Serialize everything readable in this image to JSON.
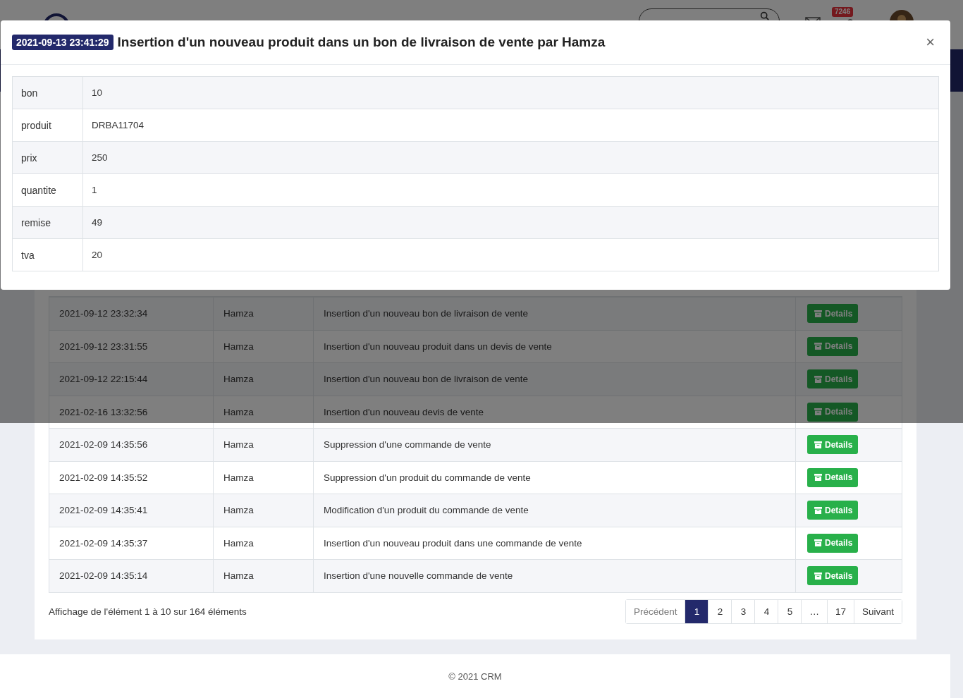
{
  "header": {
    "notification_count": "7246"
  },
  "modal": {
    "timestamp": "2021-09-13 23:41:29",
    "title": "Insertion d'un nouveau produit dans un bon de livraison de vente par Hamza",
    "close": "×",
    "fields": [
      {
        "label": "bon",
        "value": "10"
      },
      {
        "label": "produit",
        "value": "DRBA11704"
      },
      {
        "label": "prix",
        "value": "250"
      },
      {
        "label": "quantite",
        "value": "1"
      },
      {
        "label": "remise",
        "value": "49"
      },
      {
        "label": "tva",
        "value": "20"
      }
    ]
  },
  "table": {
    "rows": [
      {
        "date": "2021-09-12 23:32:34",
        "user": "Hamza",
        "action": "Insertion d'un nouveau bon de livraison de vente",
        "button": "Details"
      },
      {
        "date": "2021-09-12 23:31:55",
        "user": "Hamza",
        "action": "Insertion d'un nouveau produit dans un devis de vente",
        "button": "Details"
      },
      {
        "date": "2021-09-12 22:15:44",
        "user": "Hamza",
        "action": "Insertion d'un nouveau bon de livraison de vente",
        "button": "Details"
      },
      {
        "date": "2021-02-16 13:32:56",
        "user": "Hamza",
        "action": "Insertion d'un nouveau devis de vente",
        "button": "Details"
      },
      {
        "date": "2021-02-09 14:35:56",
        "user": "Hamza",
        "action": "Suppression d'une commande de vente",
        "button": "Details"
      },
      {
        "date": "2021-02-09 14:35:52",
        "user": "Hamza",
        "action": "Suppression d'un produit du commande de vente",
        "button": "Details"
      },
      {
        "date": "2021-02-09 14:35:41",
        "user": "Hamza",
        "action": "Modification d'un produit du commande de vente",
        "button": "Details"
      },
      {
        "date": "2021-02-09 14:35:37",
        "user": "Hamza",
        "action": "Insertion d'un nouveau produit dans une commande de vente",
        "button": "Details"
      },
      {
        "date": "2021-02-09 14:35:14",
        "user": "Hamza",
        "action": "Insertion d'une nouvelle commande de vente",
        "button": "Details"
      }
    ]
  },
  "pagination": {
    "info": "Affichage de l'élément 1 à 10 sur 164 éléments",
    "prev": "Précédent",
    "pages": [
      {
        "label": "1",
        "selected": true
      },
      {
        "label": "2",
        "selected": false
      },
      {
        "label": "3",
        "selected": false
      },
      {
        "label": "4",
        "selected": false
      },
      {
        "label": "5",
        "selected": false
      },
      {
        "label": "…",
        "selected": false
      },
      {
        "label": "17",
        "selected": false
      }
    ],
    "next": "Suivant"
  },
  "footer": "© 2021 CRM"
}
